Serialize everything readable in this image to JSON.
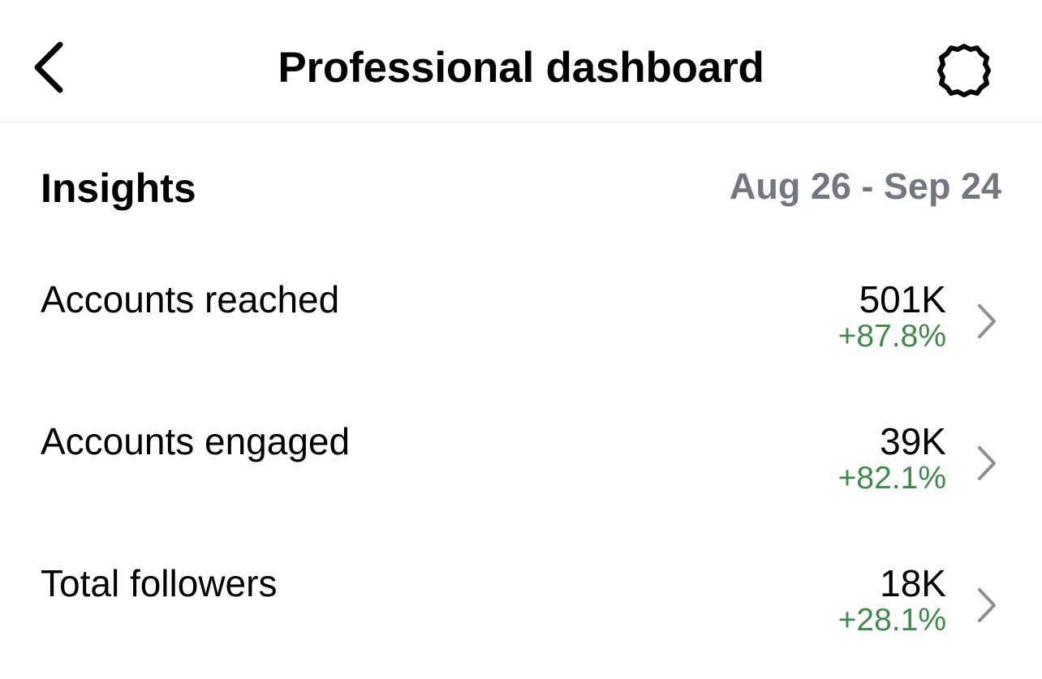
{
  "header": {
    "title": "Professional dashboard",
    "back_icon": "chevron-left-icon",
    "settings_icon": "gear-icon"
  },
  "insights": {
    "title": "Insights",
    "date_range": "Aug 26 - Sep 24"
  },
  "metrics": [
    {
      "label": "Accounts reached",
      "value": "501K",
      "change": "+87.8%"
    },
    {
      "label": "Accounts engaged",
      "value": "39K",
      "change": "+82.1%"
    },
    {
      "label": "Total followers",
      "value": "18K",
      "change": "+28.1%"
    }
  ],
  "colors": {
    "positive_change": "#3f8a4a",
    "secondary_text": "#737880",
    "chevron": "#8e8e93",
    "divider": "#e6e6e6"
  }
}
